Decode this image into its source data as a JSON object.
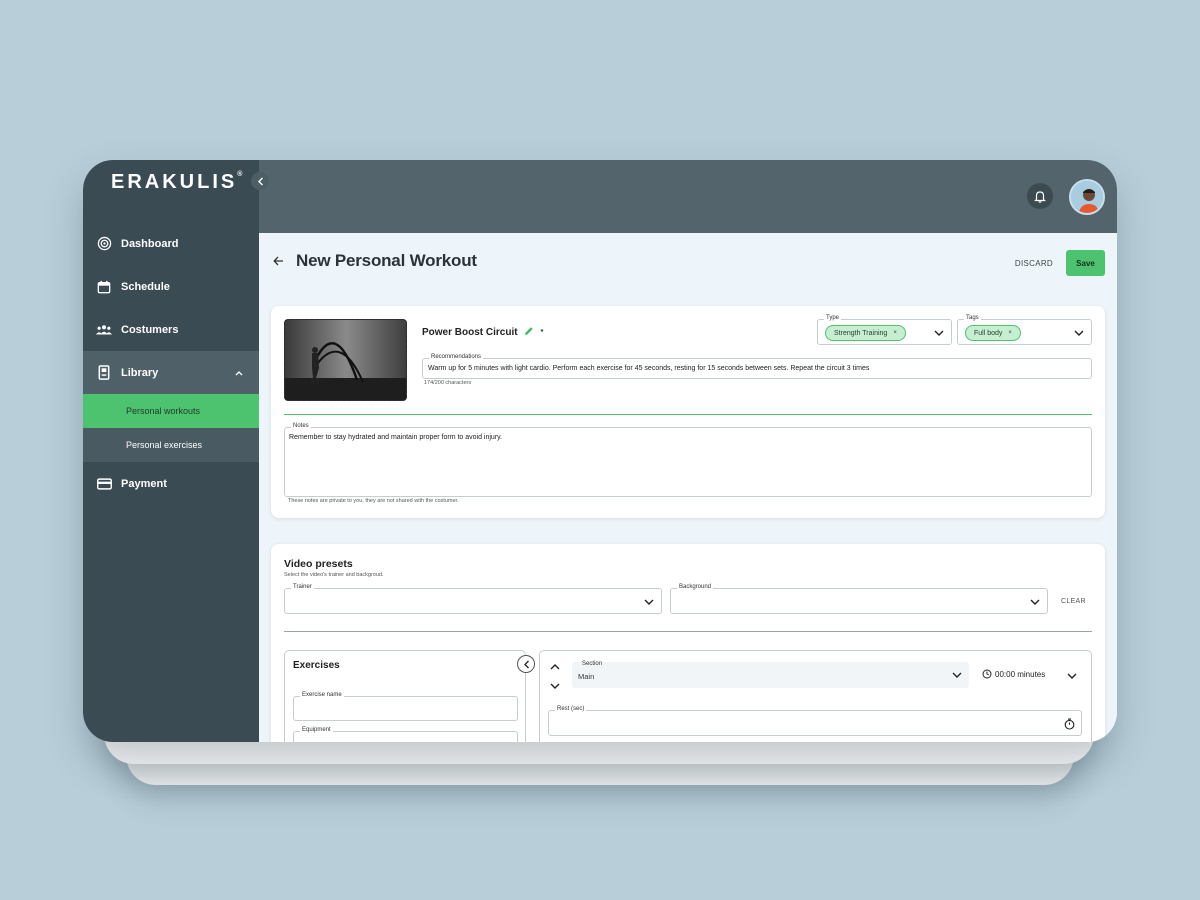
{
  "sidebar": {
    "logo": "ERAKULIS",
    "logo_mark": "®",
    "items": [
      {
        "label": "Dashboard"
      },
      {
        "label": "Schedule"
      },
      {
        "label": "Costumers"
      },
      {
        "label": "Library"
      },
      {
        "label": "Payment"
      }
    ],
    "library_sub": [
      {
        "label": "Personal workouts"
      },
      {
        "label": "Personal exercises"
      }
    ]
  },
  "header": {
    "title": "New Personal Workout",
    "discard_label": "DISCARD",
    "save_label": "Save"
  },
  "workout": {
    "name": "Power Boost Circuit",
    "required_mark": "*",
    "type_label": "Type",
    "type_chip": "Strength Training",
    "tags_label": "Tags",
    "tags_chip": "Full body",
    "chip_remove": "×",
    "recommendations_label": "Recommendations",
    "recommendations_value": "Warm up for 5 minutes with light cardio. Perform each exercise for 45 seconds, resting for 15 seconds between sets. Repeat the circuit 3 times",
    "char_count": "174/200 characters",
    "notes_label": "Notes",
    "notes_value": "Remember to stay hydrated and maintain proper form to avoid injury.",
    "notes_hint": "These notes are private to you, they are not shared with the costumer."
  },
  "video_presets": {
    "title": "Video presets",
    "subtitle": "Select the video's trainer and backgroud.",
    "trainer_label": "Trainer",
    "background_label": "Background",
    "clear_label": "CLEAR"
  },
  "exercises": {
    "title": "Exercises",
    "name_label": "Exercise name",
    "equipment_label": "Equipment"
  },
  "section_panel": {
    "section_label": "Section",
    "section_value": "Main",
    "duration": "00:00 minutes",
    "rest_label": "Rest (sec)"
  },
  "colors": {
    "accent": "#4dc26f",
    "sidebar": "#3b4b53",
    "topbar": "#53646d"
  }
}
